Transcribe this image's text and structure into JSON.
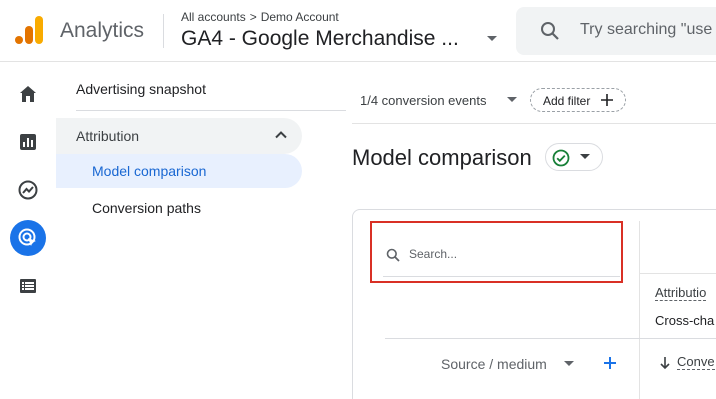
{
  "header": {
    "app_name": "Analytics",
    "breadcrumb": {
      "root": "All accounts",
      "separator": ">",
      "account": "Demo Account"
    },
    "property_name": "GA4 - Google Merchandise ...",
    "search_placeholder": "Try searching \"use"
  },
  "rail": {
    "items": [
      {
        "icon": "home-icon"
      },
      {
        "icon": "reports-icon"
      },
      {
        "icon": "explore-icon"
      },
      {
        "icon": "advertising-icon",
        "active": true
      },
      {
        "icon": "configure-icon"
      }
    ]
  },
  "subnav": {
    "advertising_snapshot": "Advertising snapshot",
    "attribution_group": "Attribution",
    "model_comparison": "Model comparison",
    "conversion_paths": "Conversion paths"
  },
  "main": {
    "conversion_events": "1/4 conversion events",
    "add_filter": "Add filter",
    "page_title": "Model comparison",
    "table": {
      "search_placeholder": "Search...",
      "attribution_label": "Attributio",
      "attribution_value": "Cross-cha",
      "dimension_label": "Source / medium",
      "metric_label": "Conve"
    }
  },
  "colors": {
    "accent": "#1a73e8",
    "highlight": "#d93025",
    "success": "#188038"
  }
}
